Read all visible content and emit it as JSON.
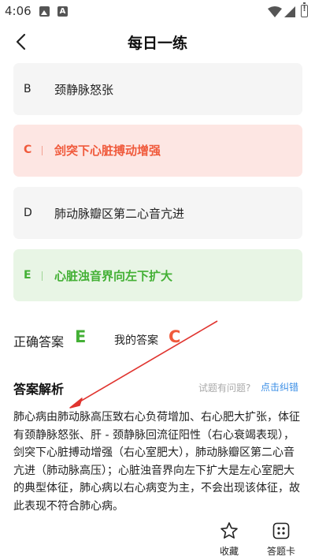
{
  "status_bar": {
    "time": "4:06",
    "icons": [
      "gallery-icon",
      "a-badge-icon",
      "wifi-icon",
      "signal-icon",
      "battery-alert-icon"
    ]
  },
  "header": {
    "title": "每日一练"
  },
  "options": [
    {
      "letter": "B",
      "text": "颈静脉怒张",
      "state": "normal"
    },
    {
      "letter": "C",
      "text": "剑突下心脏搏动增强",
      "state": "wrong"
    },
    {
      "letter": "D",
      "text": "肺动脉瓣区第二心音亢进",
      "state": "normal"
    },
    {
      "letter": "E",
      "text": "心脏浊音界向左下扩大",
      "state": "correct"
    }
  ],
  "answer": {
    "correct_label": "正确答案",
    "correct_value": "E",
    "my_label": "我的答案",
    "my_value": "C"
  },
  "analysis": {
    "title": "答案解析",
    "hint": "试题有问题?",
    "report_link": "点击纠错",
    "text": "肺心病由肺动脉高压致右心负荷增加、右心肥大扩张，体征有颈静脉怒张、肝 - 颈静脉回流征阳性（右心衰竭表现），剑突下心脏搏动增强（右心室肥大），肺动脉瓣区第二心音亢进（肺动脉高压）；心脏浊音界向左下扩大是左心室肥大的典型体征，肺心病以右心病变为主，不会出现该体征，故此表现不符合肺心病。"
  },
  "bottom_bar": {
    "favorite_label": "收藏",
    "answer_card_label": "答题卡"
  },
  "colors": {
    "correct": "#43b035",
    "wrong": "#f05a3c",
    "link": "#3a8ee6",
    "annotation_arrow": "#e0342f"
  }
}
